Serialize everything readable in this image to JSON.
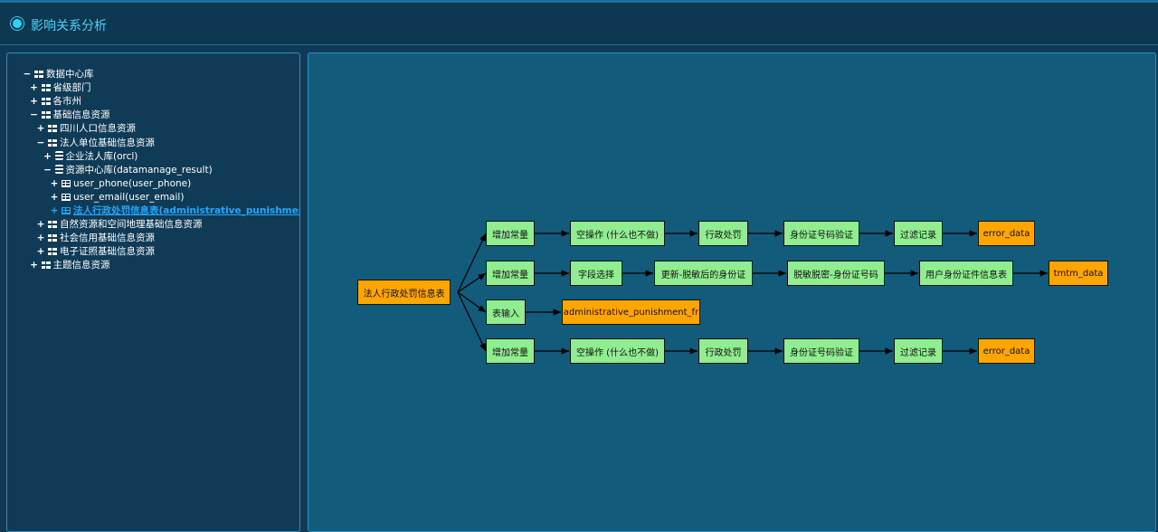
{
  "header": {
    "title": "影响关系分析"
  },
  "tree": {
    "items": [
      {
        "label": "数据中心库",
        "toggle": "−",
        "icon": "grid",
        "level": 0
      },
      {
        "label": "省级部门",
        "toggle": "+",
        "icon": "grid",
        "level": 1
      },
      {
        "label": "各市州",
        "toggle": "+",
        "icon": "grid",
        "level": 1
      },
      {
        "label": "基础信息资源",
        "toggle": "−",
        "icon": "grid",
        "level": 1
      },
      {
        "label": "四川人口信息资源",
        "toggle": "+",
        "icon": "grid",
        "level": 2
      },
      {
        "label": "法人单位基础信息资源",
        "toggle": "−",
        "icon": "grid",
        "level": 2
      },
      {
        "label": "企业法人库(orcl)",
        "toggle": "+",
        "icon": "database",
        "level": 3
      },
      {
        "label": "资源中心库(datamanage_result)",
        "toggle": "−",
        "icon": "database",
        "level": 3
      },
      {
        "label": "user_phone(user_phone)",
        "toggle": "+",
        "icon": "table",
        "level": 4
      },
      {
        "label": "user_email(user_email)",
        "toggle": "+",
        "icon": "table",
        "level": 4
      },
      {
        "label": "法人行政处罚信息表(administrative_punishment_fr)",
        "toggle": "+",
        "icon": "table",
        "level": 4,
        "selected": true
      },
      {
        "label": "自然资源和空间地理基础信息资源",
        "toggle": "+",
        "icon": "grid",
        "level": 2
      },
      {
        "label": "社会信用基础信息资源",
        "toggle": "+",
        "icon": "grid",
        "level": 2
      },
      {
        "label": "电子证照基础信息资源",
        "toggle": "+",
        "icon": "grid",
        "level": 2
      },
      {
        "label": "主题信息资源",
        "toggle": "+",
        "icon": "grid",
        "level": 1
      }
    ]
  },
  "graph": {
    "source": "法人行政处罚信息表",
    "row1": [
      "增加常量",
      "空操作 (什么也不做)",
      "行政处罚",
      "身份证号码验证",
      "过滤记录",
      "error_data"
    ],
    "row2": [
      "增加常量",
      "字段选择",
      "更新-脱敏后的身份证",
      "脱敏脱密-身份证号码",
      "用户身份证件信息表",
      "tmtm_data"
    ],
    "row3": [
      "表输入",
      "administrative_punishment_fr"
    ],
    "row4": [
      "增加常量",
      "空操作 (什么也不做)",
      "行政处罚",
      "身份证号码验证",
      "过滤记录",
      "error_data"
    ]
  },
  "colors": {
    "step_node": "#90ee90",
    "output_node": "#ffa500",
    "accent": "#4fd1f7",
    "selected_tree_item": "#1da7ff"
  }
}
